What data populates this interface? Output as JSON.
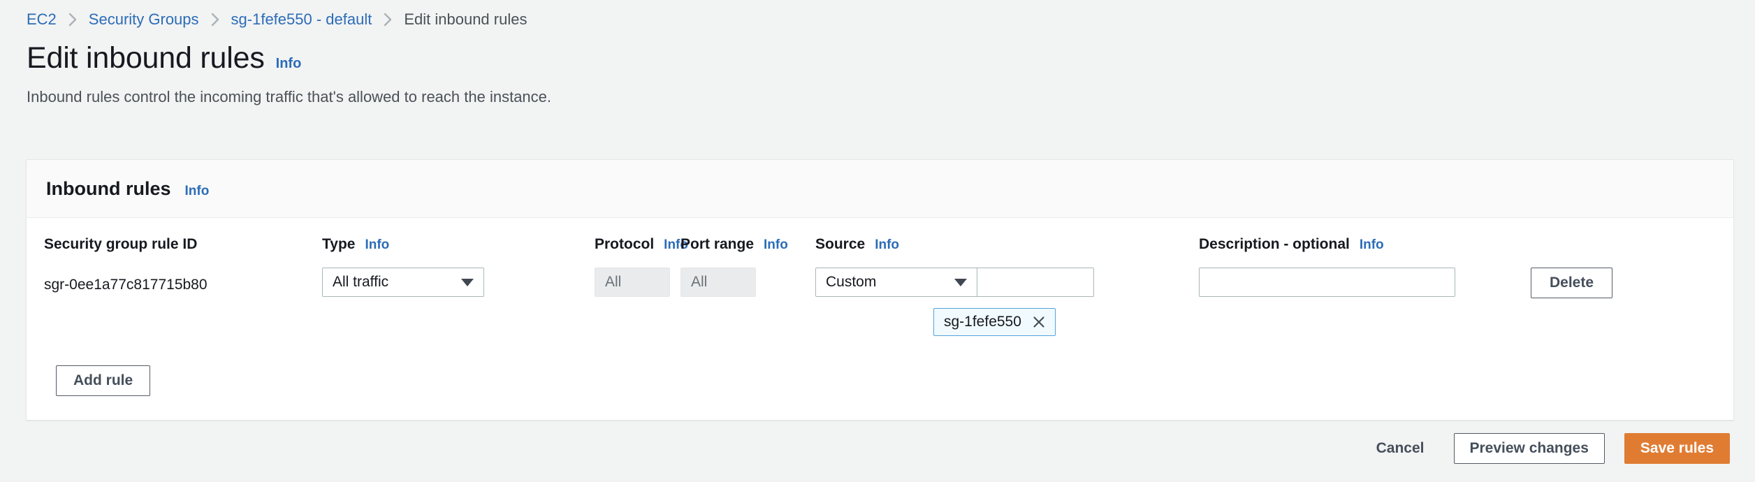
{
  "breadcrumb": {
    "items": [
      {
        "label": "EC2",
        "current": false
      },
      {
        "label": "Security Groups",
        "current": false
      },
      {
        "label": "sg-1fefe550 - default",
        "current": false
      },
      {
        "label": "Edit inbound rules",
        "current": true
      }
    ]
  },
  "header": {
    "title": "Edit inbound rules",
    "info_label": "Info",
    "description": "Inbound rules control the incoming traffic that's allowed to reach the instance."
  },
  "card": {
    "title": "Inbound rules",
    "info_label": "Info"
  },
  "columns": {
    "rule_id": {
      "label": "Security group rule ID",
      "info": ""
    },
    "type": {
      "label": "Type",
      "info": "Info"
    },
    "protocol": {
      "label": "Protocol",
      "info": "Info"
    },
    "port_range": {
      "label": "Port range",
      "info": "Info"
    },
    "source": {
      "label": "Source",
      "info": "Info"
    },
    "description": {
      "label": "Description - optional",
      "info": "Info"
    }
  },
  "rules": [
    {
      "rule_id": "sgr-0ee1a77c817715b80",
      "type_value": "All traffic",
      "protocol_placeholder": "All",
      "protocol_value": "",
      "port_range_placeholder": "All",
      "port_range_value": "",
      "source_select_value": "Custom",
      "source_search_value": "",
      "source_search_placeholder": "",
      "source_tokens": [
        {
          "label": "sg-1fefe550"
        }
      ],
      "description_value": "",
      "description_placeholder": "",
      "delete_label": "Delete"
    }
  ],
  "actions": {
    "add_rule_label": "Add rule",
    "cancel_label": "Cancel",
    "preview_label": "Preview changes",
    "save_label": "Save rules"
  },
  "icons": {
    "chevron_right": "chevron-right-icon",
    "search": "search-icon",
    "close": "close-icon",
    "caret_down": "caret-down-icon"
  },
  "colors": {
    "link": "#2b6cb8",
    "primary": "#e07c32",
    "page_bg": "#f2f3f3",
    "token_border": "#55a3dc",
    "token_bg": "#f1faff"
  }
}
